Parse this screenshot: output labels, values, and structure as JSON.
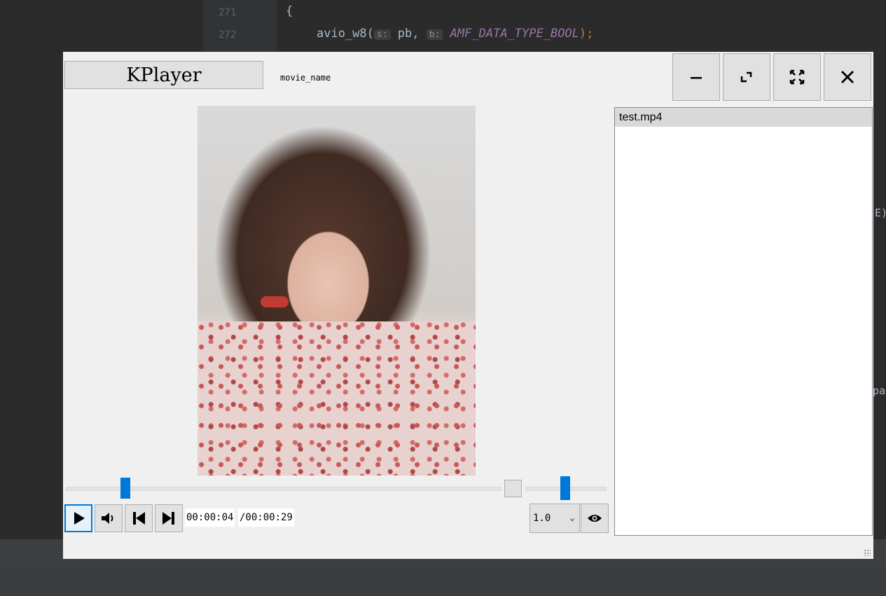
{
  "ide": {
    "lines": [
      {
        "num": "271",
        "code": "{"
      },
      {
        "num": "272",
        "fn": "avio_w8(",
        "hint1": "s:",
        "arg1": "pb,",
        "hint2": "b:",
        "const": "AMF_DATA_TYPE_BOOL",
        "tail": ");"
      }
    ],
    "fragment_right_1": "E)",
    "fragment_right_2": "pa"
  },
  "player": {
    "title": "KPlayer",
    "movie_name": "movie_name",
    "window_buttons": [
      {
        "name": "minimize-button",
        "icon": "minimize-icon"
      },
      {
        "name": "restore-button",
        "icon": "restore-icon"
      },
      {
        "name": "fullscreen-button",
        "icon": "fullscreen-icon"
      },
      {
        "name": "close-button",
        "icon": "close-icon"
      }
    ],
    "controls": {
      "current_time": "00:00:04",
      "total_time": "/00:00:29",
      "seek_progress": 0.14,
      "volume_level": 0.6,
      "speed": "1.0"
    },
    "playlist": [
      {
        "label": "test.mp4",
        "selected": true
      }
    ]
  },
  "colors": {
    "accent": "#0078d7",
    "window_bg": "#f0f0f0",
    "button_bg": "#e1e1e1"
  }
}
